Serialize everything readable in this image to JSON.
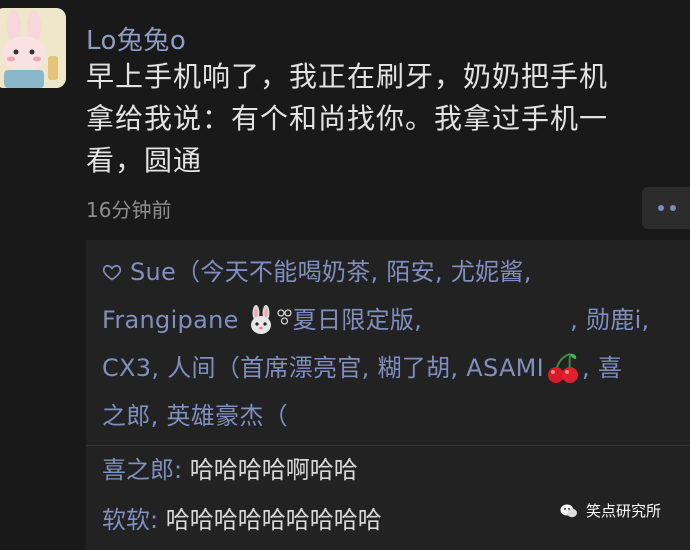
{
  "post": {
    "author": "Lo兔兔o",
    "text": "早上手机响了，我正在刷牙，奶奶把手机\n拿给我说：有个和尚找你。我拿过手机一\n看，圆通",
    "time": "16分钟前"
  },
  "likes": {
    "line1": "Sue（今天不能喝奶茶, 陌安, 尤妮酱,",
    "line2a": "Frangipane",
    "line2b": "夏日限定版,",
    "line2c": ", 勋鹿i,",
    "line3a": "CX3, 人间（首席漂亮官, 糊了胡, ASAMI",
    "line3b": ", 喜",
    "line4": "之郎, 英雄豪杰（"
  },
  "comments": [
    {
      "name": "喜之郎:",
      "text": " 哈哈哈哈啊哈哈"
    },
    {
      "name": "软软:",
      "text": " 哈哈哈哈哈哈哈哈哈"
    }
  ],
  "watermark": "笑点研究所",
  "colors": {
    "background": "#191919",
    "name_link": "#8f9cc4",
    "likes_link": "#7f8fbf",
    "panel": "#222222"
  },
  "icons": [
    "rabbit-avatar-icon",
    "heart-outline-icon",
    "rabbit-emoji-icon",
    "cherry-emoji-icon",
    "more-dots-icon",
    "wechat-icon"
  ]
}
